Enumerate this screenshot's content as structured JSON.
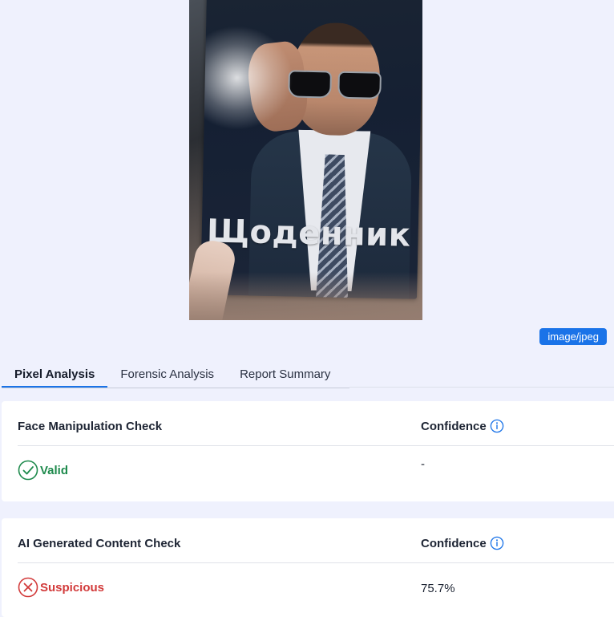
{
  "image_preview": {
    "cover_text": "Щоденник",
    "mime_type": "image/jpeg"
  },
  "tabs": [
    {
      "label": "Pixel Analysis",
      "active": true
    },
    {
      "label": "Forensic Analysis",
      "active": false
    },
    {
      "label": "Report Summary",
      "active": false
    }
  ],
  "checks": [
    {
      "title": "Face Manipulation Check",
      "confidence_label": "Confidence",
      "status": "Valid",
      "status_icon": "check-circle-icon",
      "confidence_value": "-"
    },
    {
      "title": "AI Generated Content Check",
      "confidence_label": "Confidence",
      "status": "Suspicious",
      "status_icon": "x-circle-icon",
      "confidence_value": "75.7%"
    }
  ],
  "colors": {
    "accent": "#1a73e8",
    "valid": "#1e8a4c",
    "suspicious": "#d23a3a",
    "background": "#eff1fd"
  }
}
